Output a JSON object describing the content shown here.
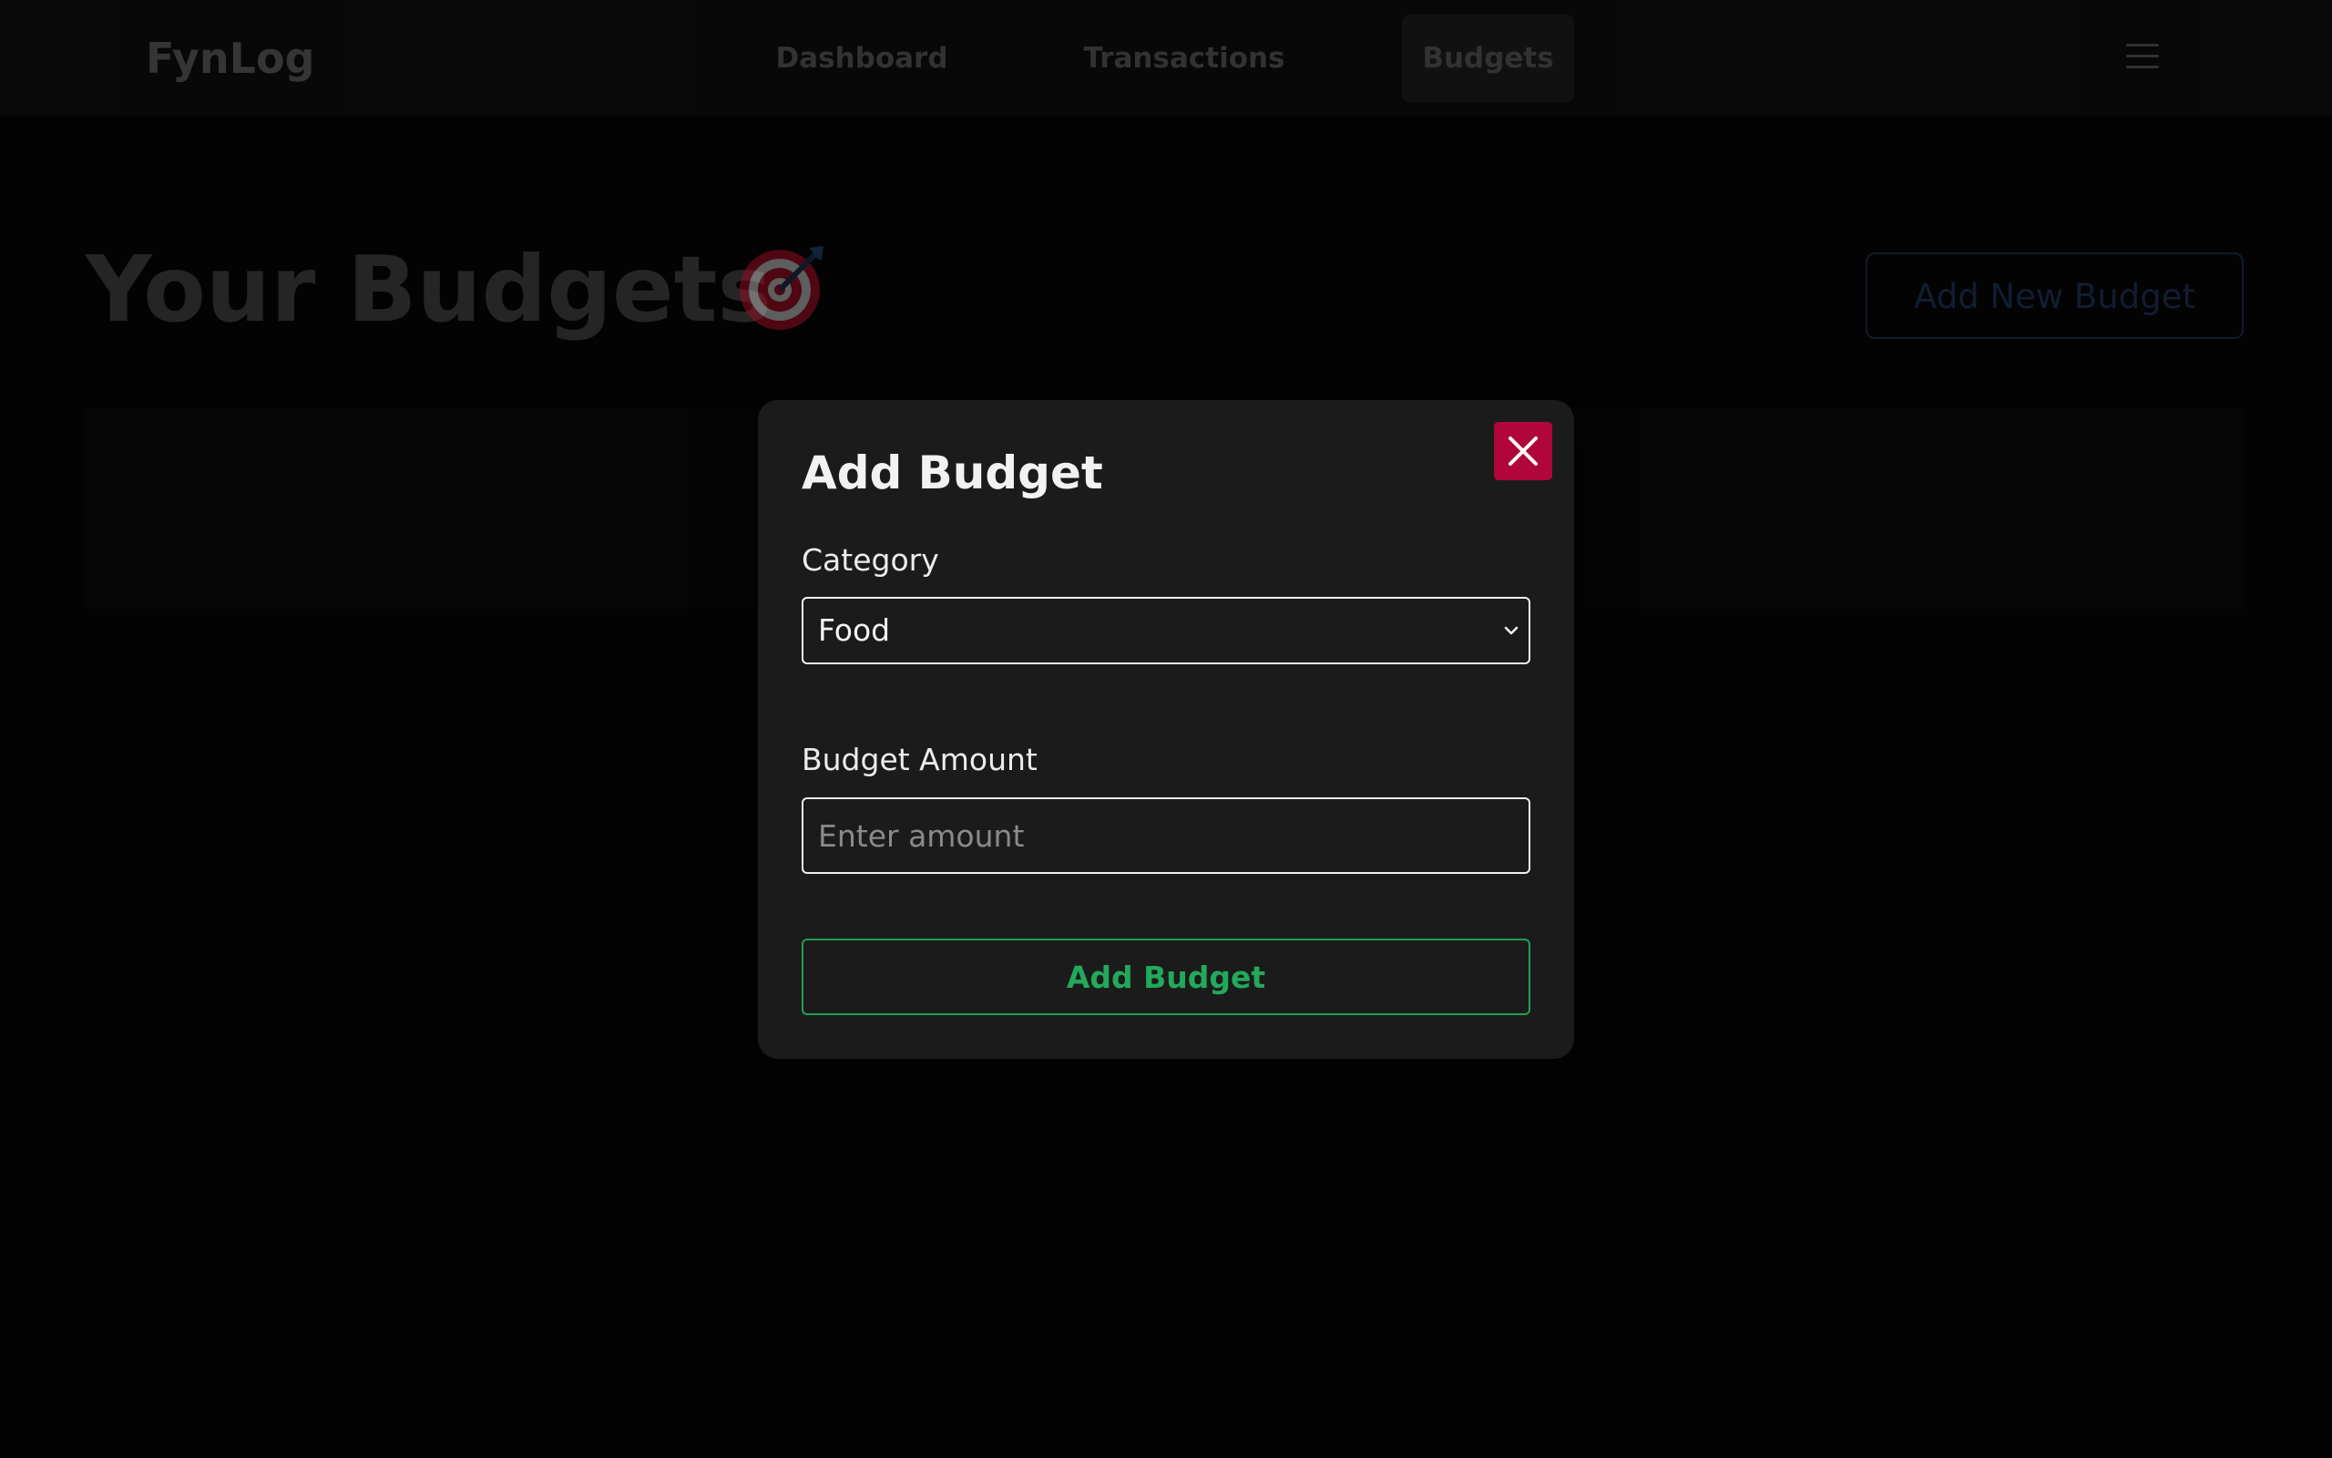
{
  "app": {
    "brand": "FynLog"
  },
  "nav": {
    "links": [
      {
        "label": "Dashboard"
      },
      {
        "label": "Transactions"
      },
      {
        "label": "Budgets",
        "active": true
      }
    ],
    "menu_icon": "hamburger-menu-icon"
  },
  "page": {
    "title": "Your Budgets",
    "title_icon": "target-dart-icon",
    "add_new_label": "Add New Budget"
  },
  "modal": {
    "title": "Add Budget",
    "close_icon": "close-icon",
    "close_color": "#b0063c",
    "category_label": "Category",
    "category_value": "Food",
    "amount_label": "Budget Amount",
    "amount_placeholder": "Enter amount",
    "amount_value": "",
    "submit_label": "Add Budget",
    "submit_color": "#22a95b"
  }
}
